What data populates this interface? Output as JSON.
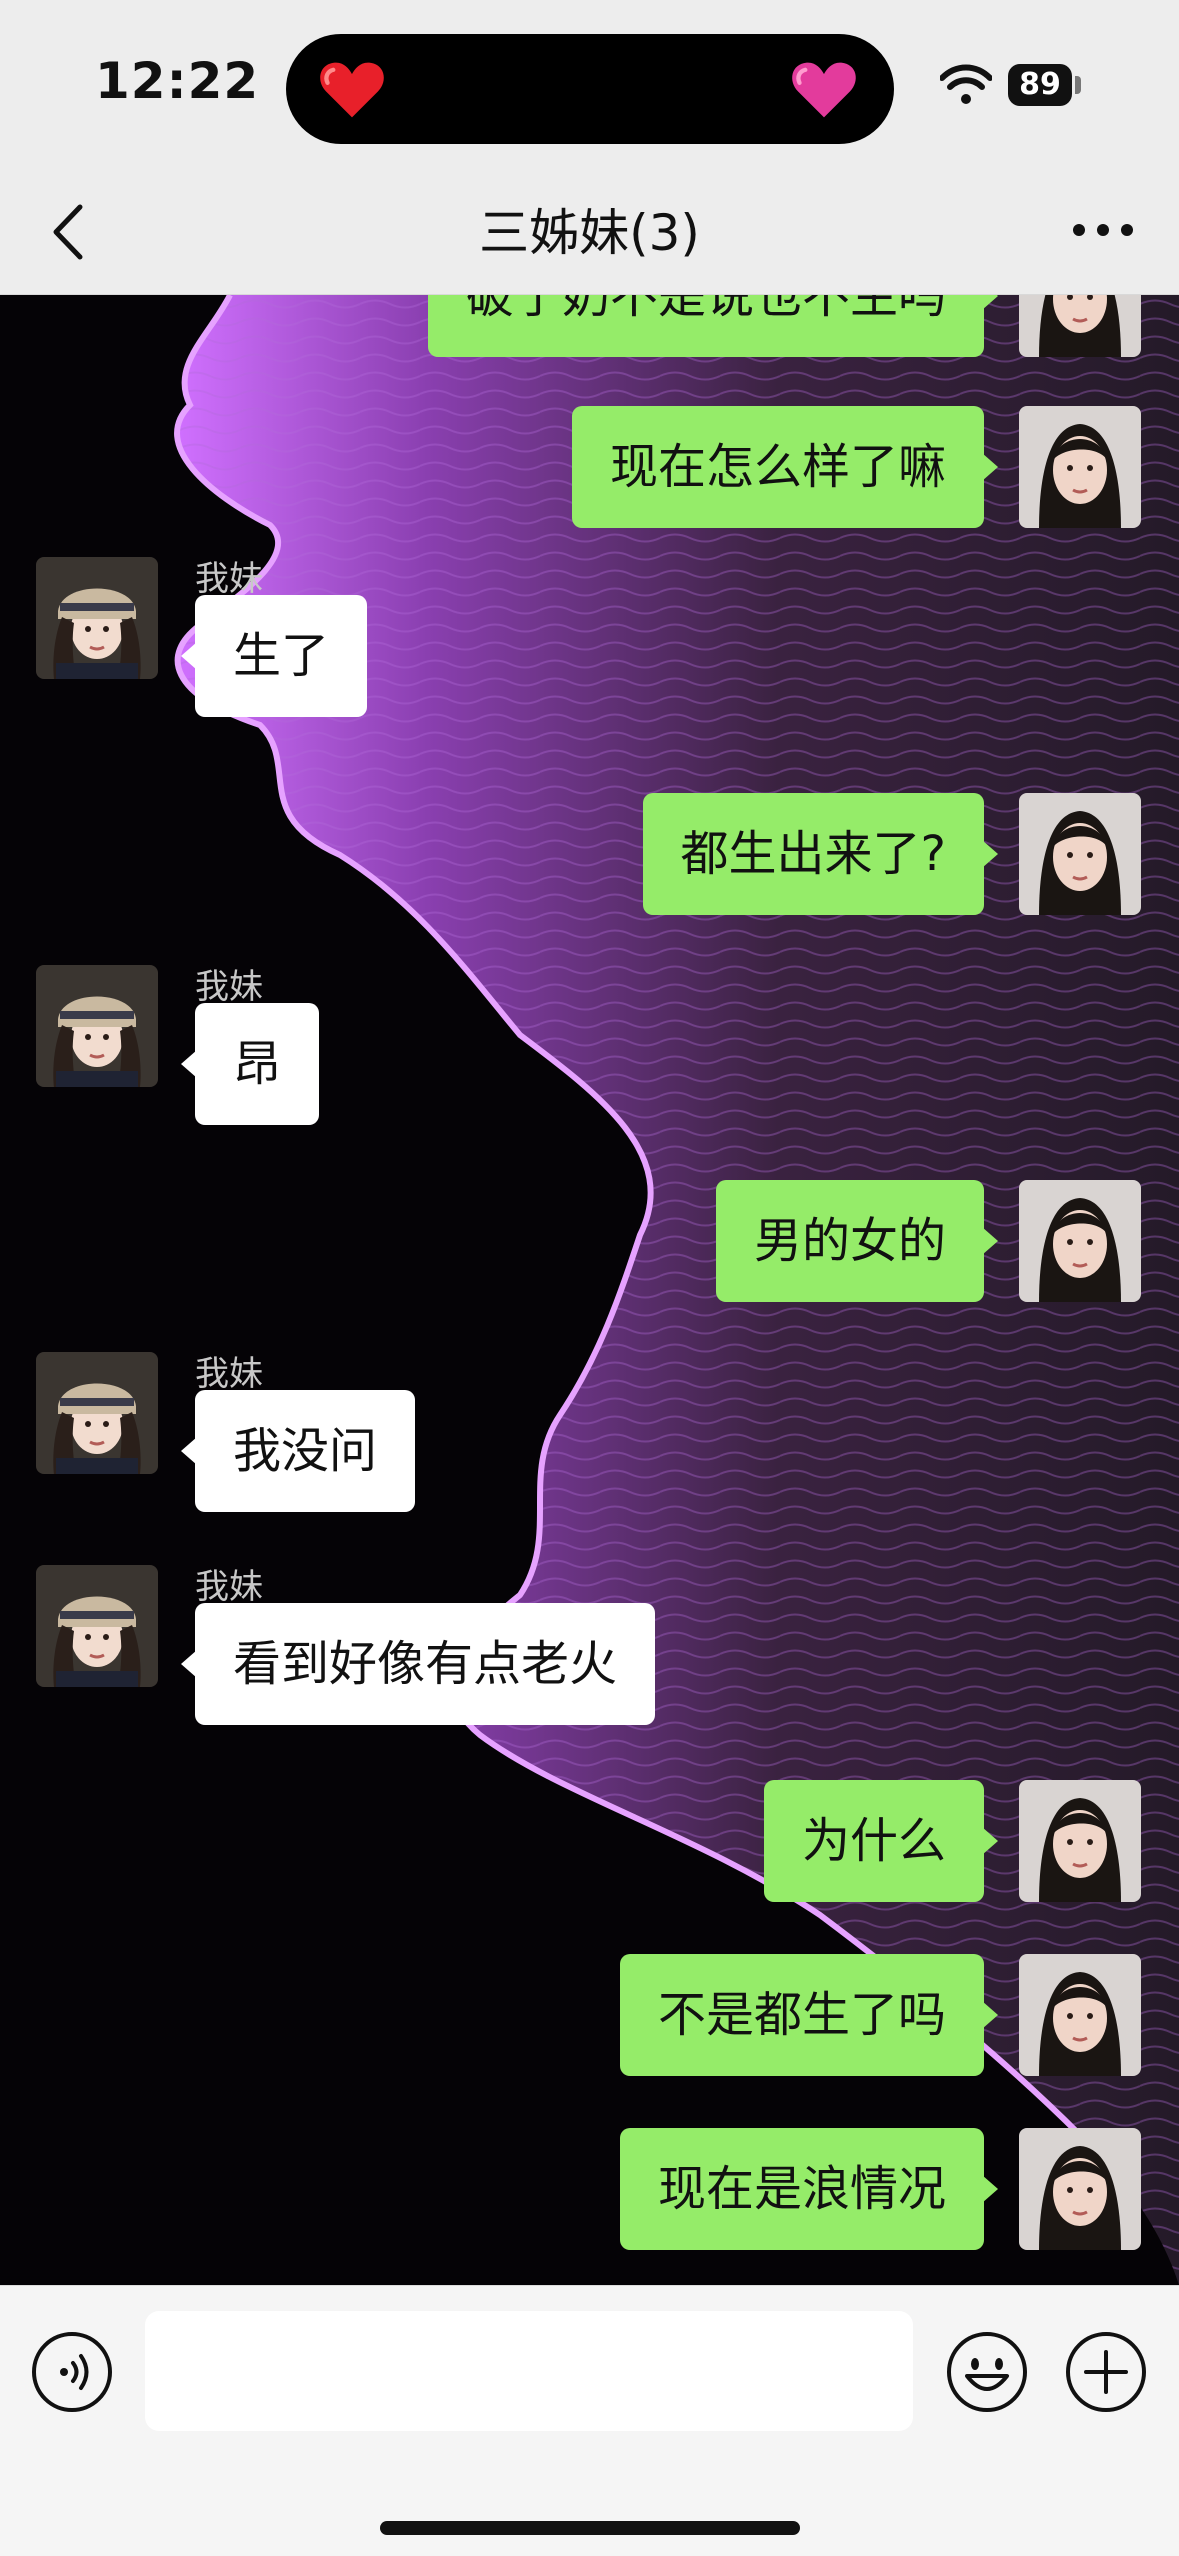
{
  "status_bar": {
    "time": "12:22",
    "battery": "89",
    "island_left_emoji": "red-heart",
    "island_right_emoji": "pink-heart"
  },
  "nav": {
    "title": "三姊妹(3)",
    "back_icon": "chevron-left-icon",
    "more_icon": "more-dots-icon"
  },
  "colors": {
    "outgoing_bubble": "#95ec69",
    "incoming_bubble": "#ffffff",
    "accent_wave": "#c060ff"
  },
  "messages": [
    {
      "from": "me",
      "text": "破了奶不是说也不生吗"
    },
    {
      "from": "me",
      "text": "现在怎么样了嘛"
    },
    {
      "from": "other",
      "sender": "我妹",
      "text": "生了"
    },
    {
      "from": "me",
      "text": "都生出来了?"
    },
    {
      "from": "other",
      "sender": "我妹",
      "text": "昂"
    },
    {
      "from": "me",
      "text": "男的女的"
    },
    {
      "from": "other",
      "sender": "我妹",
      "text": "我没问"
    },
    {
      "from": "other",
      "sender": "我妹",
      "text": "看到好像有点老火"
    },
    {
      "from": "me",
      "text": "为什么"
    },
    {
      "from": "me",
      "text": "不是都生了吗"
    },
    {
      "from": "me",
      "text": "现在是浪情况"
    }
  ],
  "input_bar": {
    "placeholder": "",
    "voice_icon": "voice-icon",
    "emoji_icon": "emoji-icon",
    "plus_icon": "plus-icon"
  }
}
